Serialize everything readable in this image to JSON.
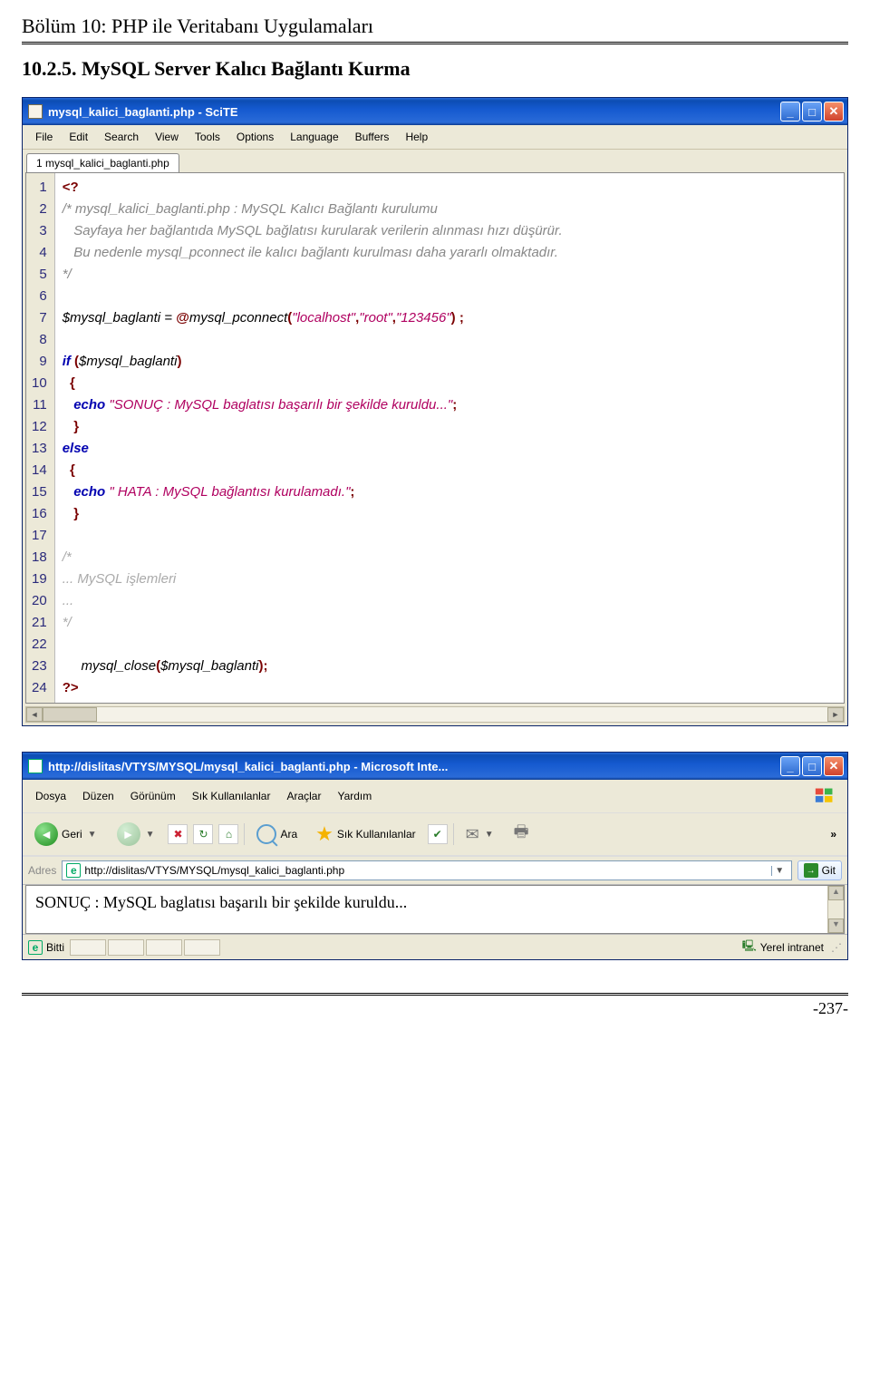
{
  "page": {
    "header": "Bölüm 10: PHP ile Veritabanı Uygulamaları",
    "section_title": "10.2.5. MySQL Server Kalıcı Bağlantı Kurma",
    "footer_page": "-237-"
  },
  "scite": {
    "title": "mysql_kalici_baglanti.php - SciTE",
    "menu": [
      "File",
      "Edit",
      "Search",
      "View",
      "Tools",
      "Options",
      "Language",
      "Buffers",
      "Help"
    ],
    "tab": "1 mysql_kalici_baglanti.php",
    "line_numbers": [
      "1",
      "2",
      "3",
      "4",
      "5",
      "6",
      "7",
      "8",
      "9",
      "10",
      "11",
      "12",
      "13",
      "14",
      "15",
      "16",
      "17",
      "18",
      "19",
      "20",
      "21",
      "22",
      "23",
      "24"
    ],
    "lines": {
      "l1_open": "<?",
      "l2": "/* mysql_kalici_baglanti.php : MySQL Kalıcı Bağlantı kurulumu",
      "l3": "   Sayfaya her bağlantıda MySQL bağlatısı kurularak verilerin alınması hızı düşürür.",
      "l4": "   Bu nedenle mysql_pconnect ile kalıcı bağlantı kurulması daha yararlı olmaktadır.",
      "l5": "*/",
      "l7_var": "$mysql_baglanti",
      "l7_eq": " = ",
      "l7_at": "@",
      "l7_fn": "mysql_pconnect",
      "l7_paren_o": "(",
      "l7_s1": "\"localhost\"",
      "l7_c1": ",",
      "l7_s2": "\"root\"",
      "l7_c2": ",",
      "l7_s3": "\"123456\"",
      "l7_paren_c": ") ;",
      "l9_if": "if ",
      "l9_cond_o": "(",
      "l9_cond_var": "$mysql_baglanti",
      "l9_cond_c": ")",
      "l10": "  {",
      "l11_echo": "   echo ",
      "l11_str": "\"SONUÇ : MySQL baglatısı başarılı bir şekilde kuruldu...\"",
      "l11_end": ";",
      "l12": "   }",
      "l13_else": "else",
      "l14": "  {",
      "l15_echo": "   echo ",
      "l15_str": "\" HATA : MySQL bağlantısı kurulamadı.\"",
      "l15_end": ";",
      "l16": "   }",
      "l18": "/*",
      "l19": "... MySQL işlemleri",
      "l20": "...",
      "l21": "*/",
      "l23_fn": "     mysql_close",
      "l23_paren_o": "(",
      "l23_var": "$mysql_baglanti",
      "l23_paren_c": ");",
      "l24_close": "?>"
    }
  },
  "ie": {
    "title": "http://dislitas/VTYS/MYSQL/mysql_kalici_baglanti.php - Microsoft Inte...",
    "menu": [
      "Dosya",
      "Düzen",
      "Görünüm",
      "Sık Kullanılanlar",
      "Araçlar",
      "Yardım"
    ],
    "back_label": "Geri",
    "search_label": "Ara",
    "fav_label": "Sık Kullanılanlar",
    "addr_label": "Adres",
    "url": "http://dislitas/VTYS/MYSQL/mysql_kalici_baglanti.php",
    "go_label": "Git",
    "content": "SONUÇ : MySQL baglatısı başarılı bir şekilde kuruldu...",
    "status_done": "Bitti",
    "status_zone": "Yerel intranet"
  }
}
